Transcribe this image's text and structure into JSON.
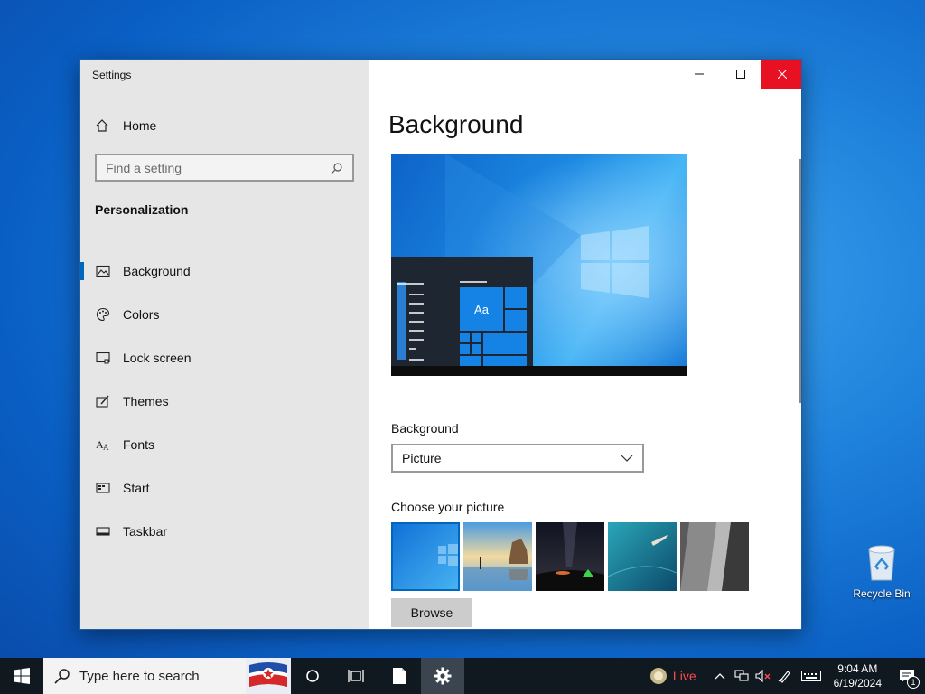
{
  "window": {
    "app_title": "Settings",
    "home_label": "Home",
    "search_placeholder": "Find a setting",
    "section_title": "Personalization",
    "nav_items": [
      {
        "label": "Background",
        "icon": "picture-icon",
        "active": true
      },
      {
        "label": "Colors",
        "icon": "palette-icon"
      },
      {
        "label": "Lock screen",
        "icon": "lock-screen-icon"
      },
      {
        "label": "Themes",
        "icon": "themes-icon"
      },
      {
        "label": "Fonts",
        "icon": "fonts-icon"
      },
      {
        "label": "Start",
        "icon": "start-icon"
      },
      {
        "label": "Taskbar",
        "icon": "taskbar-icon"
      }
    ]
  },
  "content": {
    "page_title": "Background",
    "preview_tile_text": "Aa",
    "background_label": "Background",
    "background_value": "Picture",
    "choose_label": "Choose your picture",
    "browse_label": "Browse",
    "thumbnails": [
      "windows-blue",
      "beach-rocks",
      "night-sky-tent",
      "underwater-swimmer",
      "rock-cliff"
    ]
  },
  "desktop": {
    "recycle_bin_label": "Recycle Bin"
  },
  "taskbar": {
    "search_placeholder": "Type here to search",
    "live_label": "Live",
    "time": "9:04 AM",
    "date": "6/19/2024",
    "notification_count": "1"
  },
  "colors": {
    "accent": "#0067c0",
    "close_red": "#e81123",
    "nav_bg": "#e6e6e6",
    "taskbar_bg": "#101820"
  }
}
